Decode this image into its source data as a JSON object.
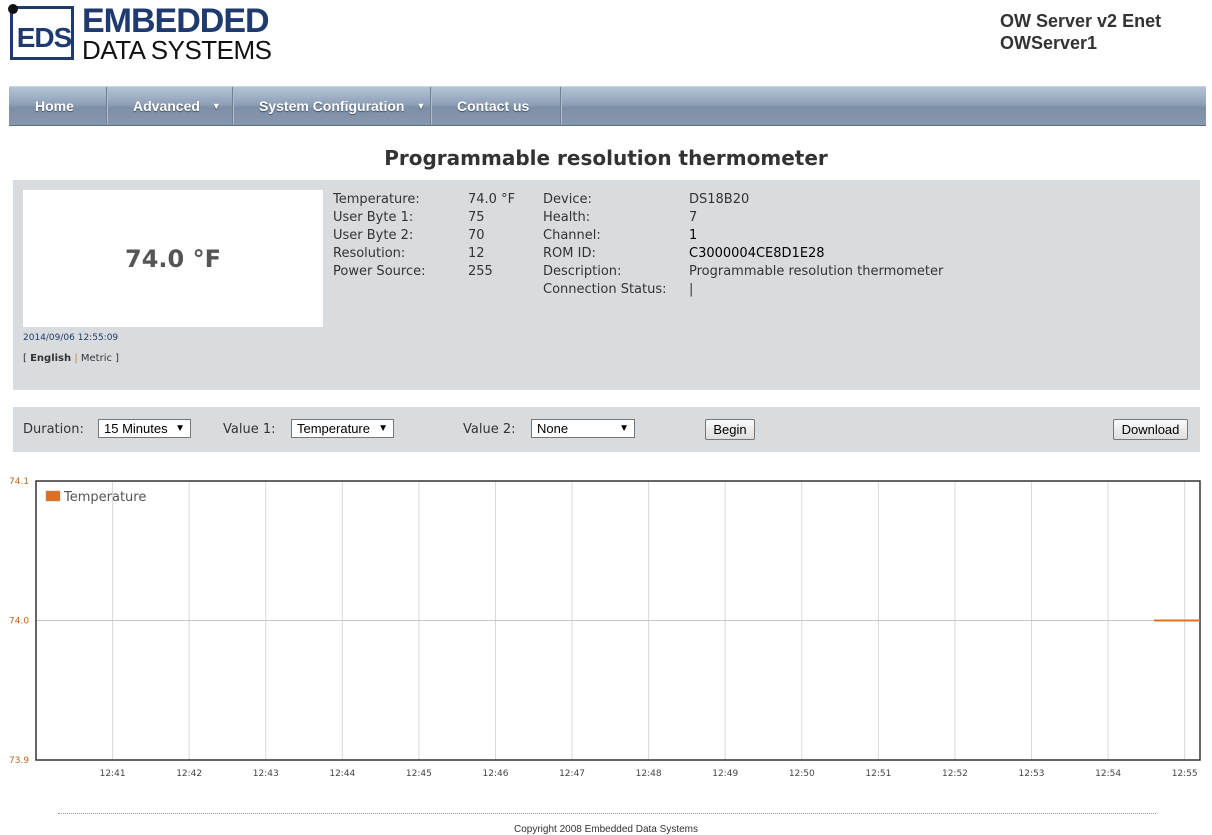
{
  "header": {
    "logo_abbrev": "EDS",
    "logo_line1": "EMBEDDED",
    "logo_line2": "DATA SYSTEMS",
    "server_model": "OW Server v2 Enet",
    "server_name": "OWServer1"
  },
  "nav": {
    "items": [
      {
        "label": "Home",
        "has_menu": false
      },
      {
        "label": "Advanced",
        "has_menu": true
      },
      {
        "label": "System Configuration",
        "has_menu": true
      },
      {
        "label": "Contact us",
        "has_menu": false
      }
    ]
  },
  "page": {
    "title": "Programmable resolution thermometer"
  },
  "device": {
    "reading": "74.0 °F",
    "timestamp": "2014/09/06 12:55:09",
    "units": {
      "open": "[",
      "english": "English",
      "sep": "|",
      "metric": "Metric",
      "close": "]"
    },
    "details_left": [
      {
        "label": "Temperature:",
        "value": "74.0 °F"
      },
      {
        "label": "User Byte 1:",
        "value": "75"
      },
      {
        "label": "User Byte 2:",
        "value": "70"
      },
      {
        "label": "Resolution:",
        "value": "12"
      },
      {
        "label": "Power Source:",
        "value": "255"
      }
    ],
    "details_right": [
      {
        "label": "Device:",
        "value": "DS18B20"
      },
      {
        "label": "Health:",
        "value": "7"
      },
      {
        "label": "Channel:",
        "value": "1"
      },
      {
        "label": "ROM ID:",
        "value": "C3000004CE8D1E28"
      },
      {
        "label": "Description:",
        "value": "Programmable resolution thermometer"
      },
      {
        "label": "Connection Status:",
        "value": "|"
      }
    ]
  },
  "controls": {
    "duration_label": "Duration:",
    "duration_value": "15 Minutes",
    "value1_label": "Value 1:",
    "value1_value": "Temperature",
    "value2_label": "Value 2:",
    "value2_value": "None",
    "begin_label": "Begin",
    "download_label": "Download"
  },
  "chart_data": {
    "type": "line",
    "title": "",
    "xlabel": "",
    "ylabel": "",
    "x_ticks": [
      "12:41",
      "12:42",
      "12:43",
      "12:44",
      "12:45",
      "12:46",
      "12:47",
      "12:48",
      "12:49",
      "12:50",
      "12:51",
      "12:52",
      "12:53",
      "12:54",
      "12:55"
    ],
    "y_ticks": [
      "74.1",
      "74.0",
      "73.9"
    ],
    "xlim": [
      "12:40",
      "12:55.2"
    ],
    "ylim": [
      73.9,
      74.1
    ],
    "grid": true,
    "legend_position": "top-left",
    "series": [
      {
        "name": "Temperature",
        "color": "#e07020",
        "points": [
          {
            "x": "12:54.6",
            "y": 74.0
          },
          {
            "x": "12:55.2",
            "y": 74.0
          }
        ]
      }
    ]
  },
  "footer": {
    "copyright": "Copyright 2008 Embedded Data Systems"
  }
}
